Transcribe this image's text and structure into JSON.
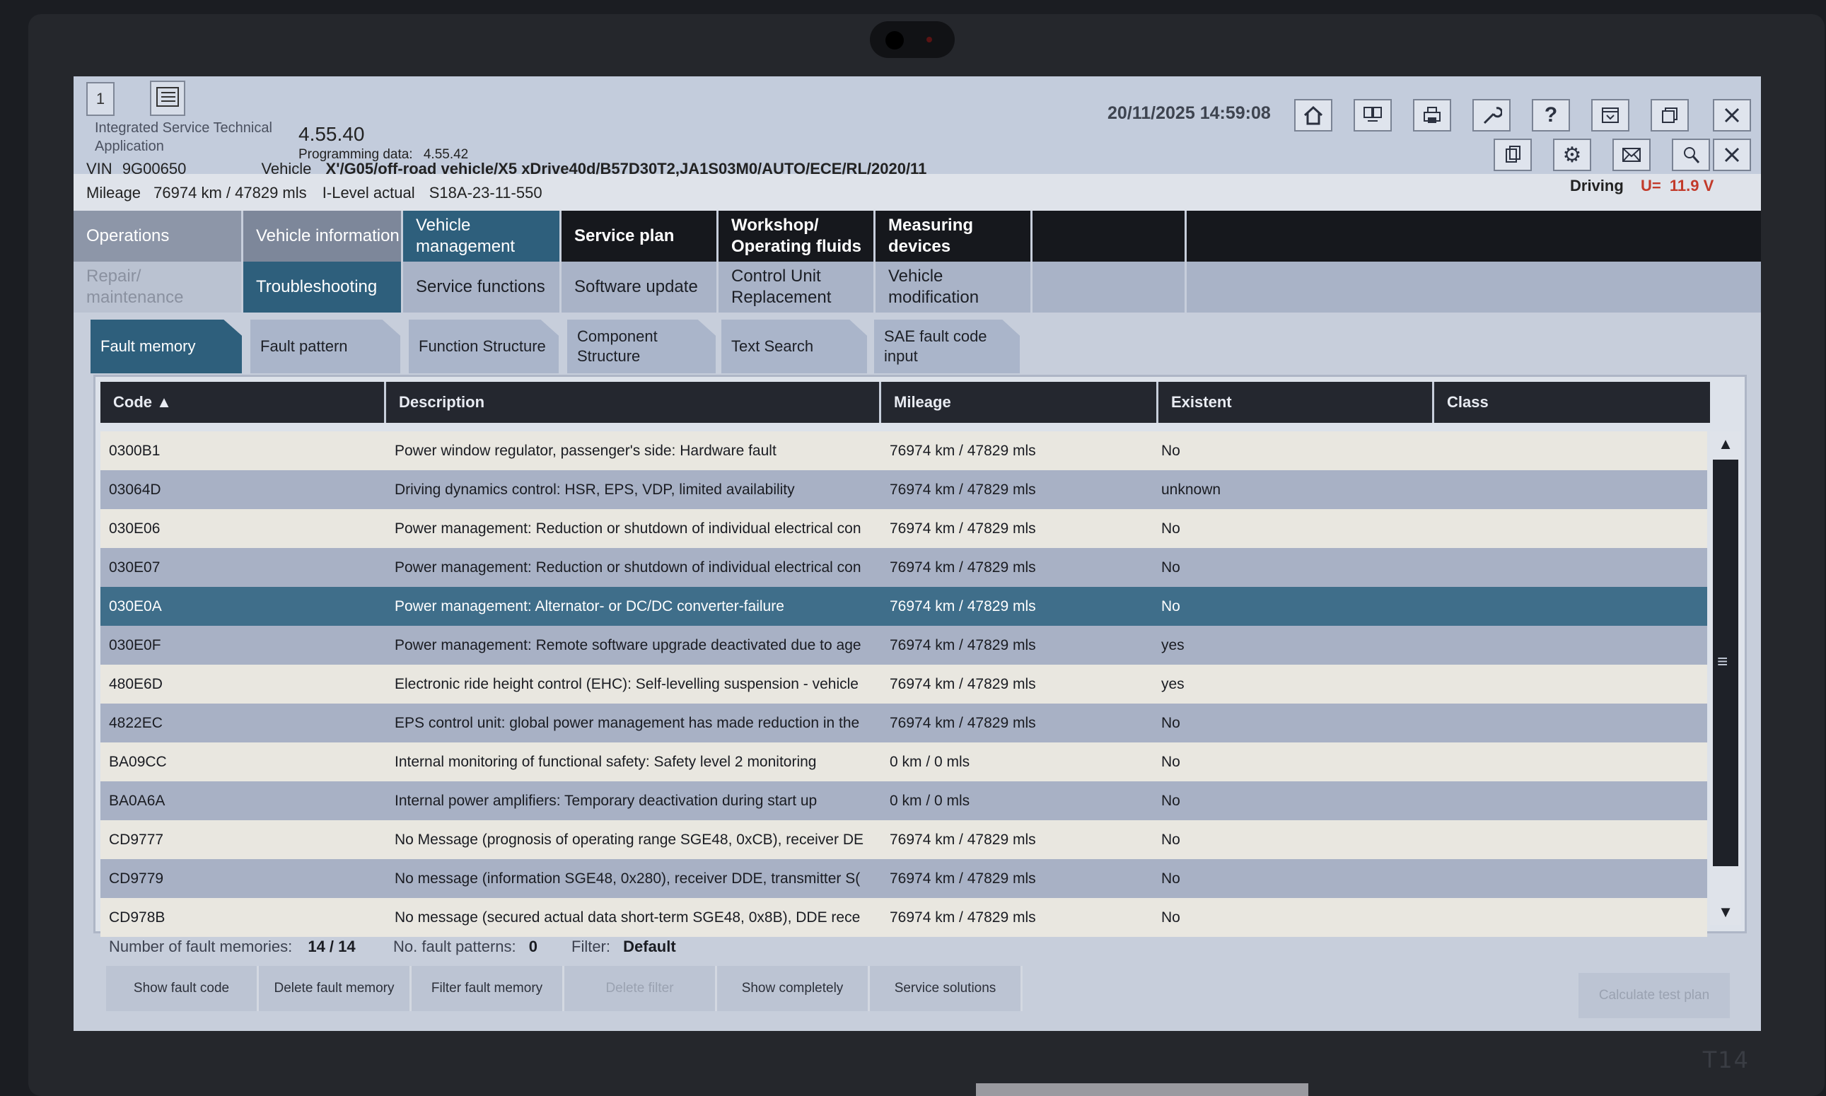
{
  "window": {
    "number": "1",
    "app_name_line1": "Integrated Service Technical",
    "app_name_line2": "Application",
    "version": "4.55.40",
    "programming_data_label": "Programming data:",
    "programming_data_value": "4.55.42",
    "datetime": "20/11/2025 14:59:08"
  },
  "vehicle": {
    "vin_label": "VIN",
    "vin": "9G00650",
    "vehicle_label": "Vehicle",
    "vehicle": "X'/G05/off-road vehicle/X5 xDrive40d/B57D30T2,JA1S03M0/AUTO/ECE/RL/2020/11",
    "mileage_label": "Mileage",
    "mileage": "76974 km / 47829 mls",
    "ilevel_label": "I-Level actual",
    "ilevel": "S18A-23-11-550",
    "driving": "Driving",
    "voltage_label": "U=",
    "voltage": "11.9 V"
  },
  "toolbar_icons": [
    "home-icon",
    "screens-icon",
    "printer-icon",
    "wrench-icon",
    "help-icon",
    "dropdown-icon",
    "restore-icon",
    "close-icon",
    "document-icon",
    "gear-icon",
    "mail-icon",
    "air-icon",
    "close-icon"
  ],
  "tabs_main": [
    {
      "label": "Operations"
    },
    {
      "label": "Vehicle information"
    },
    {
      "label": "Vehicle management"
    },
    {
      "label": "Service plan"
    },
    {
      "label": "Workshop/ Operating fluids"
    },
    {
      "label": "Measuring devices"
    }
  ],
  "tabs_secondary": [
    {
      "label": "Repair/ maintenance"
    },
    {
      "label": "Troubleshooting"
    },
    {
      "label": "Service functions"
    },
    {
      "label": "Software update"
    },
    {
      "label": "Control Unit Replacement"
    },
    {
      "label": "Vehicle modification"
    }
  ],
  "tabs_sub": [
    {
      "label": "Fault memory"
    },
    {
      "label": "Fault pattern"
    },
    {
      "label": "Function Structure"
    },
    {
      "label": "Component Structure"
    },
    {
      "label": "Text Search"
    },
    {
      "label": "SAE fault code input"
    }
  ],
  "table": {
    "headers": {
      "code": "Code ▲",
      "description": "Description",
      "mileage": "Mileage",
      "existent": "Existent",
      "class": "Class"
    },
    "rows": [
      {
        "code": "0300B1",
        "description": "Power window regulator, passenger's side: Hardware fault",
        "mileage": "76974 km / 47829 mls",
        "existent": "No"
      },
      {
        "code": "03064D",
        "description": "Driving dynamics control: HSR, EPS, VDP, limited availability",
        "mileage": "76974 km / 47829 mls",
        "existent": "unknown"
      },
      {
        "code": "030E06",
        "description": "Power management: Reduction or shutdown of individual electrical con",
        "mileage": "76974 km / 47829 mls",
        "existent": "No"
      },
      {
        "code": "030E07",
        "description": "Power management: Reduction or shutdown of individual electrical con",
        "mileage": "76974 km / 47829 mls",
        "existent": "No"
      },
      {
        "code": "030E0A",
        "description": "Power management: Alternator- or DC/DC converter-failure",
        "mileage": "76974 km / 47829 mls",
        "existent": "No"
      },
      {
        "code": "030E0F",
        "description": "Power management: Remote software upgrade deactivated due to age",
        "mileage": "76974 km / 47829 mls",
        "existent": "yes"
      },
      {
        "code": "480E6D",
        "description": "Electronic ride height control (EHC): Self-levelling suspension - vehicle",
        "mileage": "76974 km / 47829 mls",
        "existent": "yes"
      },
      {
        "code": "4822EC",
        "description": "EPS control unit: global power management has made reduction in the",
        "mileage": "76974 km / 47829 mls",
        "existent": "No"
      },
      {
        "code": "BA09CC",
        "description": "Internal monitoring of functional safety: Safety level 2 monitoring",
        "mileage": "0 km / 0 mls",
        "existent": "No"
      },
      {
        "code": "BA0A6A",
        "description": "Internal power amplifiers: Temporary deactivation during start up",
        "mileage": "0 km / 0 mls",
        "existent": "No"
      },
      {
        "code": "CD9777",
        "description": "No Message (prognosis of operating range SGE48, 0xCB), receiver DE",
        "mileage": "76974 km / 47829 mls",
        "existent": "No"
      },
      {
        "code": "CD9779",
        "description": "No message (information SGE48, 0x280), receiver DDE, transmitter S(",
        "mileage": "76974 km / 47829 mls",
        "existent": "No"
      },
      {
        "code": "CD978B",
        "description": "No message (secured actual data short-term SGE48, 0x8B), DDE rece",
        "mileage": "76974 km / 47829 mls",
        "existent": "No"
      }
    ]
  },
  "status": {
    "fault_memories_label": "Number of fault memories:",
    "fault_memories_value": "14 / 14",
    "fault_patterns_label": "No. fault patterns:",
    "fault_patterns_value": "0",
    "filter_label": "Filter:",
    "filter_value": "Default"
  },
  "buttons": {
    "show_fault_code": "Show fault code",
    "delete_fault_memory": "Delete fault memory",
    "filter_fault_memory": "Filter fault memory",
    "delete_filter": "Delete filter",
    "show_completely": "Show completely",
    "service_solutions": "Service solutions",
    "calculate_test_plan": "Calculate test plan"
  },
  "brand": "T14",
  "colors": {
    "selected_row": "#3f6e8a",
    "active_tab": "#2e5f7c",
    "voltage": "#c23a2a",
    "header_dark": "#24272f"
  }
}
